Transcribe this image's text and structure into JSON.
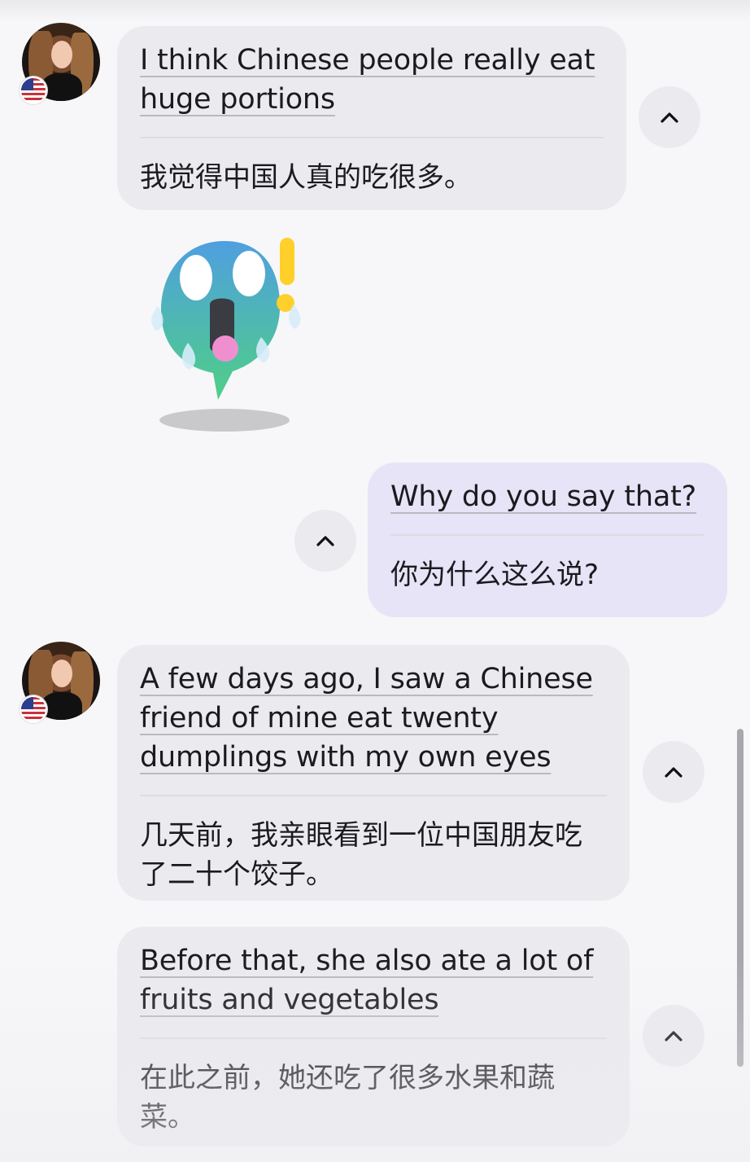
{
  "messages": [
    {
      "sender": "them",
      "english": "I think Chinese people really eat huge portions",
      "translation": "我觉得中国人真的吃很多。"
    },
    {
      "sender": "them",
      "sticker": "scared-face-sticker"
    },
    {
      "sender": "me",
      "english": "Why do you say that?",
      "translation": "你为什么这么说?"
    },
    {
      "sender": "them",
      "english": "A few days ago, I saw a Chinese friend of mine eat twenty dumplings with my own eyes",
      "translation": "几天前，我亲眼看到一位中国朋友吃了二十个饺子。"
    },
    {
      "sender": "them",
      "english": "Before that, she also ate a lot of fruits and vegetables",
      "translation": "在此之前，她还吃了很多水果和蔬菜。"
    }
  ],
  "icons": {
    "avatar": "avatar",
    "flag": "us-flag-icon",
    "collapse": "chevron-up-icon",
    "sticker": "scared-face-sticker"
  },
  "colors": {
    "incoming_bubble": "#ebebef",
    "outgoing_bubble": "#e6e4f6",
    "sticker_top": "#4f9fe0",
    "sticker_bottom": "#4fcf86"
  }
}
